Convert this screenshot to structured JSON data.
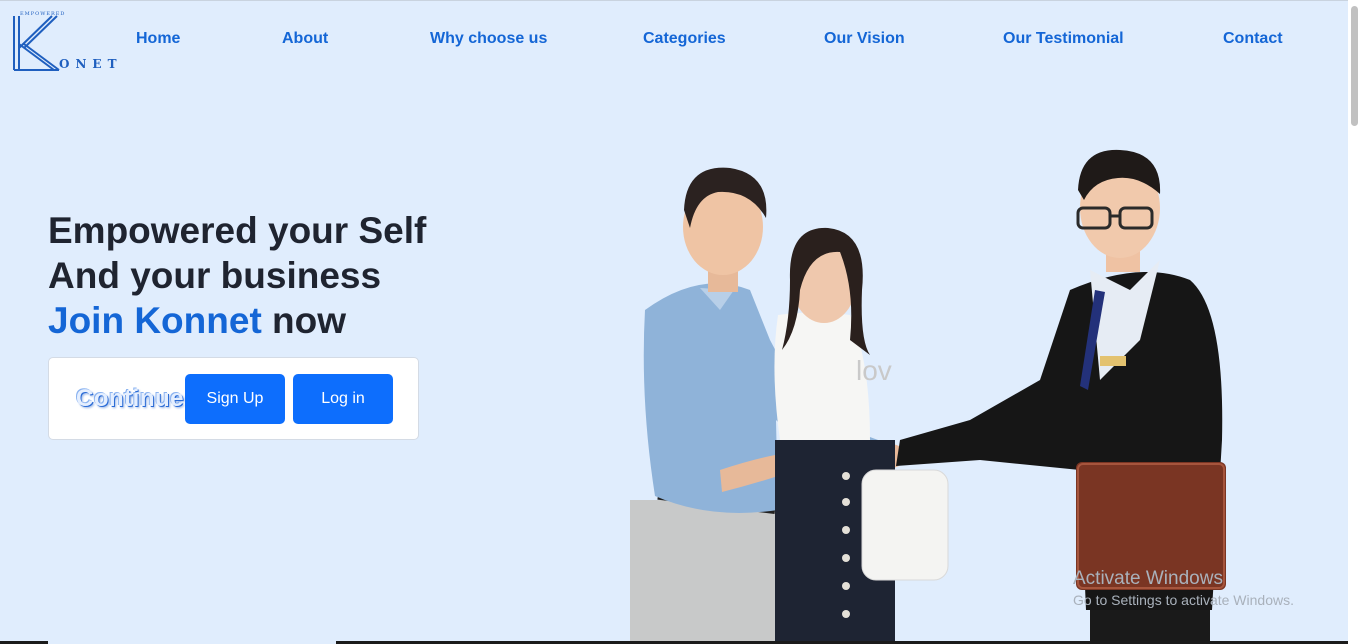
{
  "brand": {
    "tagline": "EMPOWERED",
    "name": "ONET",
    "logo_letter": "K"
  },
  "nav": {
    "items": [
      {
        "label": "Home"
      },
      {
        "label": "About"
      },
      {
        "label": "Why choose us"
      },
      {
        "label": "Categories"
      },
      {
        "label": "Our Vision"
      },
      {
        "label": "Our Testimonial"
      },
      {
        "label": "Contact"
      }
    ]
  },
  "hero": {
    "line1": "Empowered your Self",
    "line2": "And your business",
    "line3_accent": "Join Konnet",
    "line3_rest": "now"
  },
  "cta": {
    "continue_label": "Continue",
    "signup_label": "Sign Up",
    "login_label": "Log in"
  },
  "image": {
    "watermark_text": "lov"
  },
  "os_watermark": {
    "title": "Activate Windows",
    "subtitle": "Go to Settings to activate Windows."
  },
  "colors": {
    "background": "#e0edfd",
    "accent": "#1466d6",
    "button": "#0d6efd",
    "heading": "#1f2430"
  }
}
